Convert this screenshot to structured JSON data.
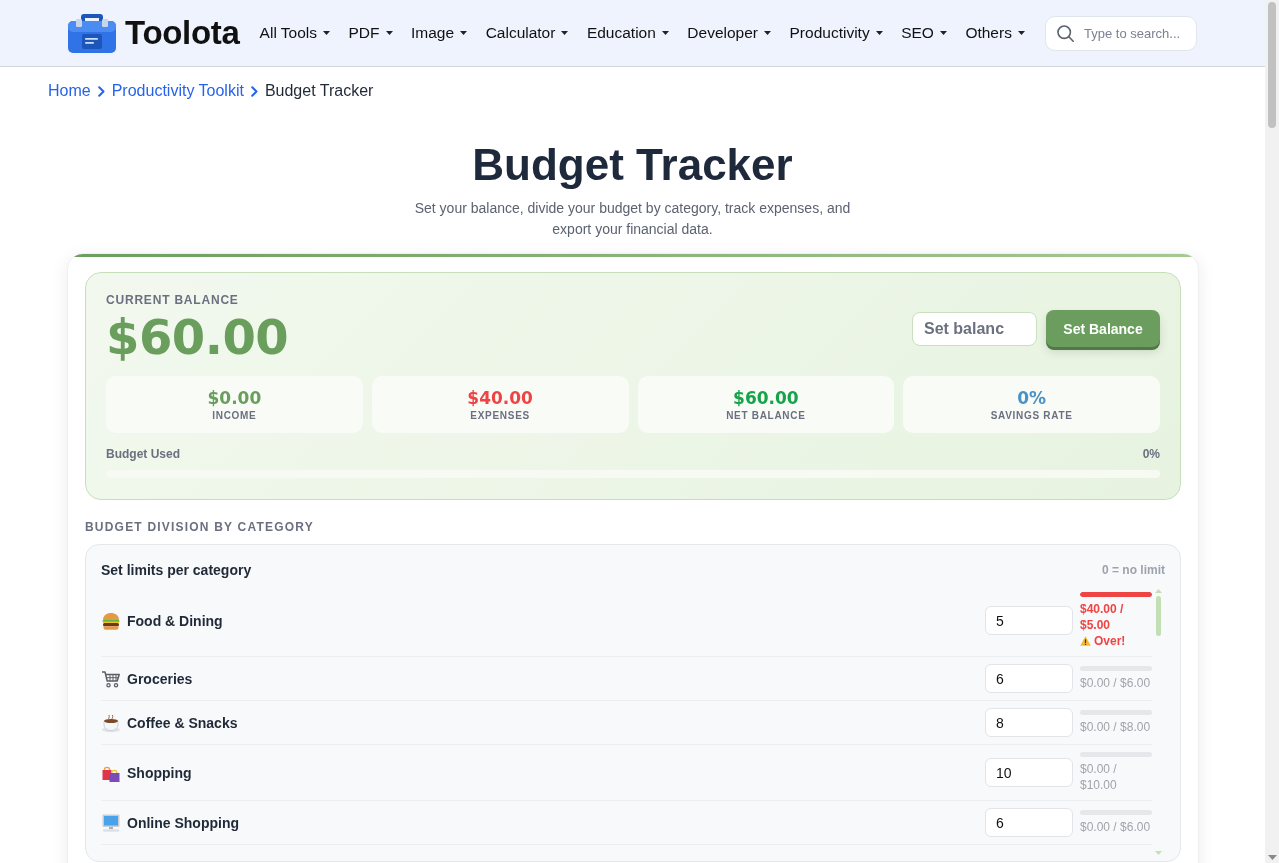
{
  "header": {
    "logo": "Toolota",
    "nav": [
      {
        "label": "All Tools"
      },
      {
        "label": "PDF"
      },
      {
        "label": "Image"
      },
      {
        "label": "Calculator"
      },
      {
        "label": "Education"
      },
      {
        "label": "Developer"
      },
      {
        "label": "Productivity"
      },
      {
        "label": "SEO"
      },
      {
        "label": "Others"
      }
    ],
    "search": {
      "placeholder": "Type to search..."
    }
  },
  "breadcrumb": [
    {
      "label": "Home",
      "current": false
    },
    {
      "label": "Productivity Toolkit",
      "current": false
    },
    {
      "label": "Budget Tracker",
      "current": true
    }
  ],
  "page": {
    "title": "Budget Tracker",
    "subtitle": "Set your balance, divide your budget by category, track expenses, and export your financial data."
  },
  "balance": {
    "label": "CURRENT BALANCE",
    "amount": "$60.00",
    "input": {
      "placeholder": "Set balanc"
    },
    "button": "Set Balance",
    "stats": [
      {
        "value": "$0.00",
        "label": "INCOME",
        "color": "#6a9e5c"
      },
      {
        "value": "$40.00",
        "label": "EXPENSES",
        "color": "#ef4444"
      },
      {
        "value": "$60.00",
        "label": "NET BALANCE",
        "color": "#16a34a"
      },
      {
        "value": "0%",
        "label": "SAVINGS RATE",
        "color": "#4a93c4"
      }
    ],
    "budget_used": {
      "label": "Budget Used",
      "reading": "0%",
      "level": 0
    }
  },
  "categories": {
    "title": "BUDGET DIVISION BY CATEGORY",
    "heading": "Set limits per category",
    "hint": "0 = no limit",
    "items": [
      {
        "name": "Food & Dining",
        "limit": "5",
        "level": 1,
        "over": true,
        "usage": "$40.00 / $5.00",
        "over_label": "Over!"
      },
      {
        "name": "Groceries",
        "limit": "6",
        "level": 0,
        "over": false,
        "usage": "$0.00 / $6.00"
      },
      {
        "name": "Coffee & Snacks",
        "limit": "8",
        "level": 0,
        "over": false,
        "usage": "$0.00 / $8.00"
      },
      {
        "name": "Shopping",
        "limit": "10",
        "level": 0,
        "over": false,
        "usage": "$0.00 / $10.00"
      },
      {
        "name": "Online Shopping",
        "limit": "6",
        "level": 0,
        "over": false,
        "usage": "$0.00 / $6.00"
      }
    ]
  }
}
